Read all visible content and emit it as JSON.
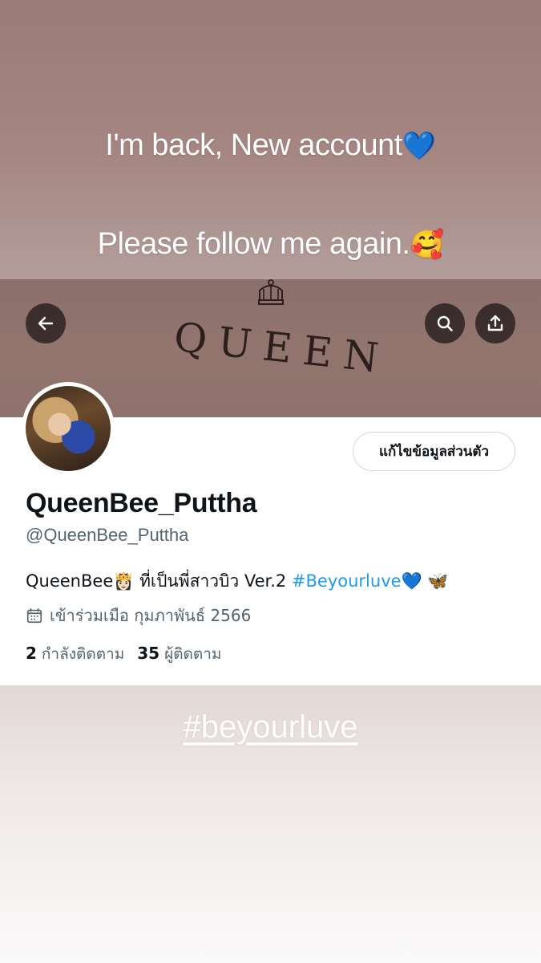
{
  "story": {
    "line1": "I'm back, New account",
    "line1_emoji": "💙",
    "line2": "Please follow me again.",
    "line2_emoji": "🥰",
    "hashtag": "#beyourluve"
  },
  "banner": {
    "word": "QUEEN",
    "icons": [
      "crown-icon",
      "back-arrow-icon",
      "search-icon",
      "share-icon"
    ]
  },
  "profile": {
    "edit_button": "แก้ไขข้อมูลส่วนตัว",
    "display_name": "QueenBee_Puttha",
    "handle": "@QueenBee_Puttha",
    "bio_prefix": "QueenBee",
    "bio_emoji1": "👸🏻",
    "bio_text": " ที่เป็นพี่สาวบิว Ver.2 ",
    "bio_tag": "#Beyourluve",
    "bio_emoji2": "💙",
    "bio_emoji3": " 🦋",
    "joined": "เข้าร่วมเมือ กุมภาพันธ์ 2566",
    "following_count": "2",
    "following_label": "กำลังติดตาม",
    "followers_count": "35",
    "followers_label": "ผู้ติดตาม"
  },
  "colors": {
    "accent": "#1d9bf0",
    "text": "#0f1419",
    "muted": "#536471"
  }
}
